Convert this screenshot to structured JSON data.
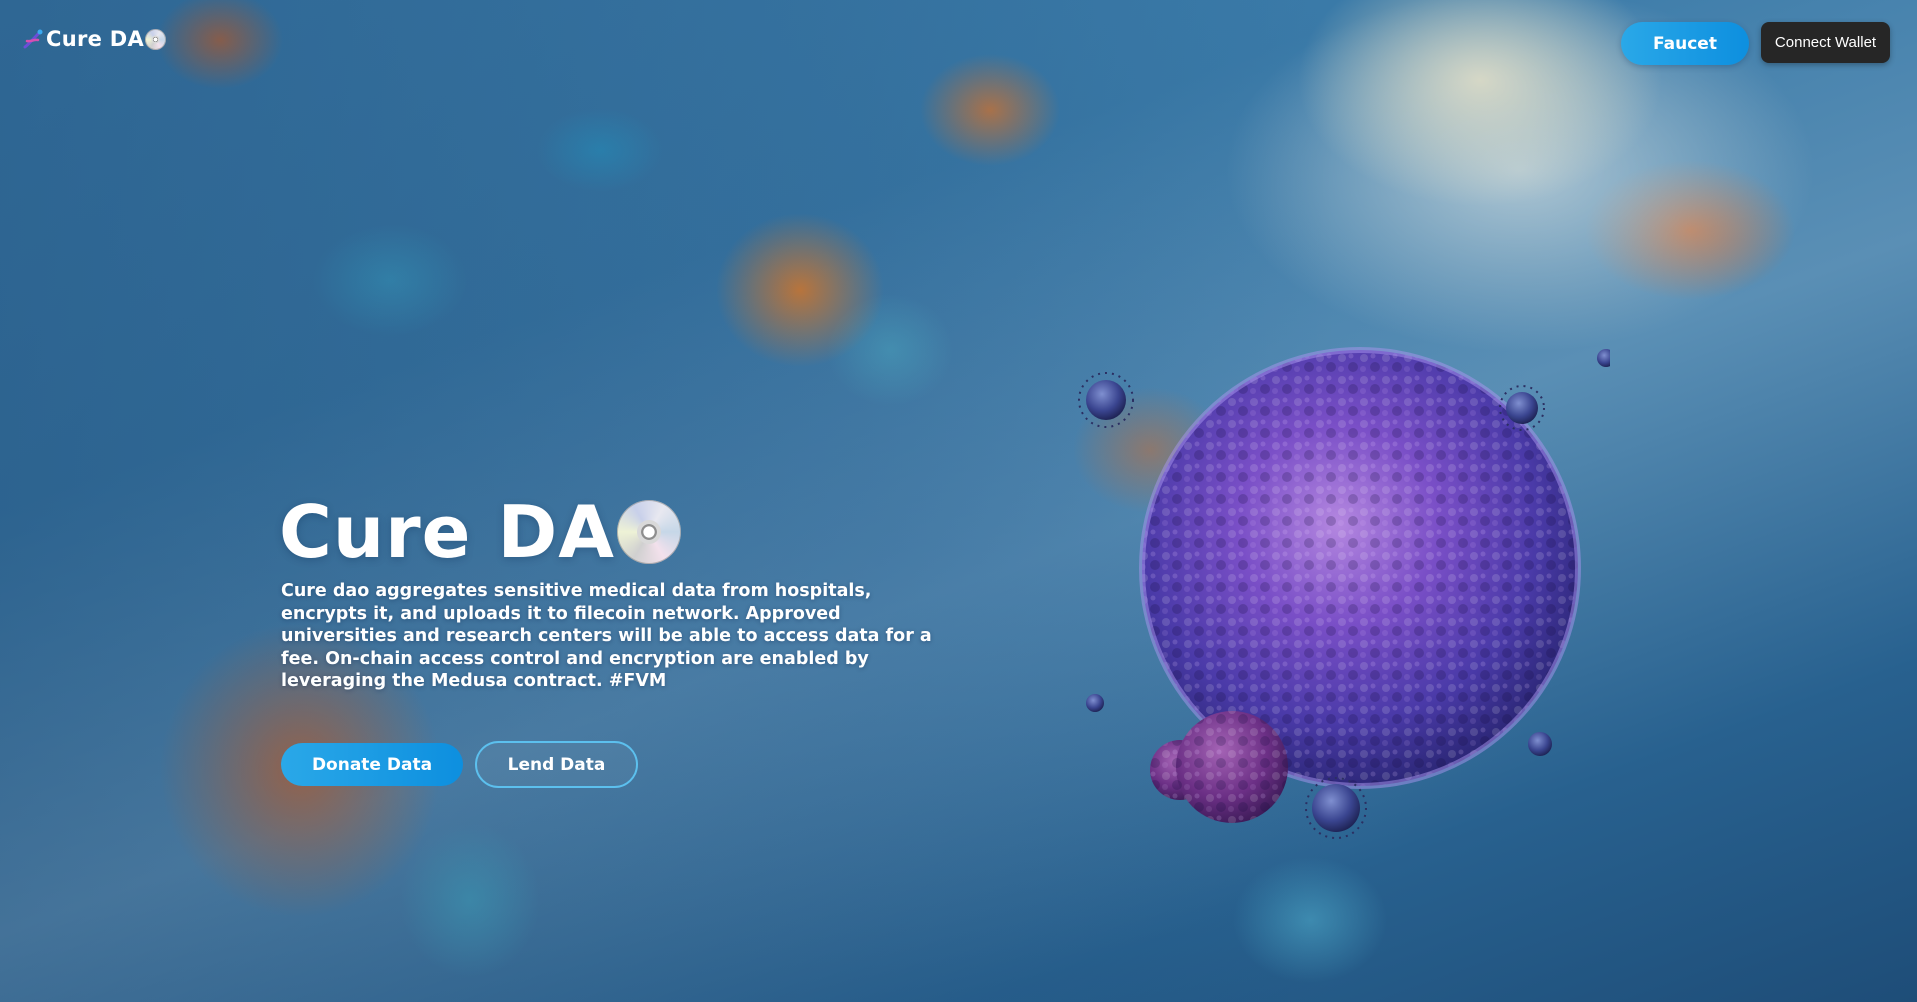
{
  "header": {
    "brand_name": "Cure DA",
    "brand_icons": [
      "dna-icon",
      "disc-icon"
    ],
    "faucet_label": "Faucet",
    "connect_wallet_label": "Connect Wallet"
  },
  "hero": {
    "title": "Cure DA",
    "title_icon": "disc-icon",
    "description": "Cure dao aggregates sensitive medical data from hospitals, encrypts it, and uploads it to filecoin network. Approved universities and research centers will be able to access data for a fee. On-chain access control and encryption are enabled by leveraging the Medusa contract. #FVM",
    "donate_label": "Donate Data",
    "lend_label": "Lend Data"
  },
  "colors": {
    "accent": "#1a9de6",
    "wallet_button": "#262626",
    "text": "#ffffff",
    "outline_button_border": "#5cc0ee"
  }
}
